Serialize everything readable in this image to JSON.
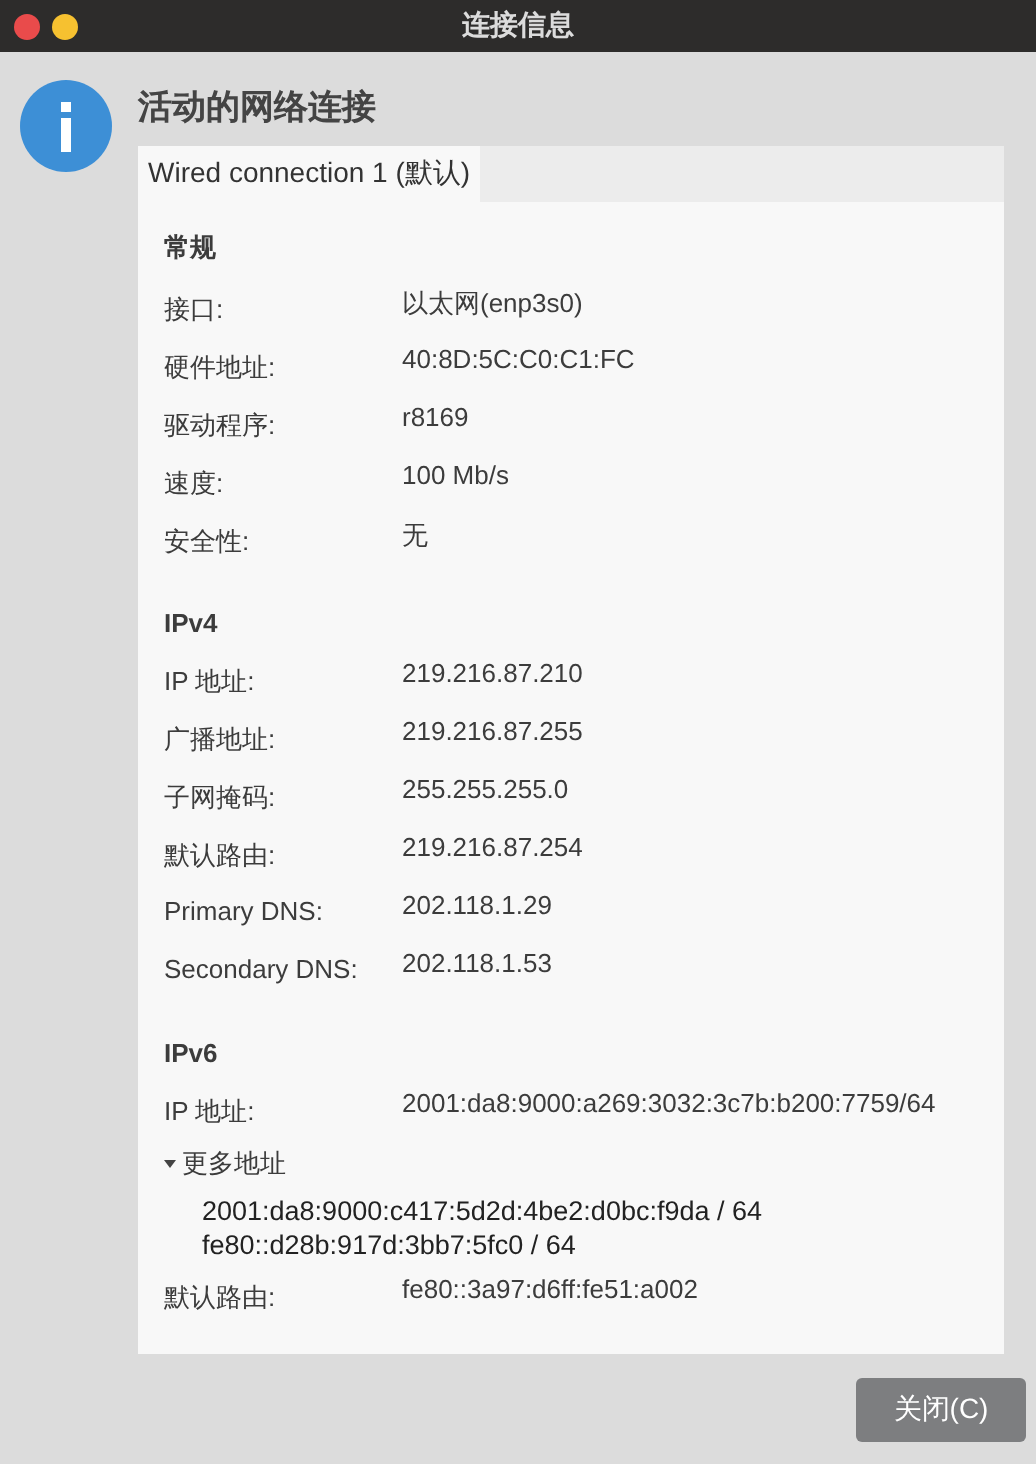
{
  "window": {
    "title": "连接信息"
  },
  "heading": "活动的网络连接",
  "tabs": [
    {
      "label": "Wired connection 1 (默认)",
      "selected": true
    }
  ],
  "sections": [
    {
      "title": "常规",
      "items": [
        {
          "kind": "field",
          "label": "接口:",
          "value": "以太网(enp3s0)"
        },
        {
          "kind": "field",
          "label": "硬件地址:",
          "value": "40:8D:5C:C0:C1:FC"
        },
        {
          "kind": "field",
          "label": "驱动程序:",
          "value": "r8169"
        },
        {
          "kind": "field",
          "label": "速度:",
          "value": "100 Mb/s"
        },
        {
          "kind": "field",
          "label": "安全性:",
          "value": "无"
        }
      ]
    },
    {
      "title": "IPv4",
      "items": [
        {
          "kind": "field",
          "label": "IP 地址:",
          "value": "219.216.87.210"
        },
        {
          "kind": "field",
          "label": "广播地址:",
          "value": "219.216.87.255"
        },
        {
          "kind": "field",
          "label": "子网掩码:",
          "value": "255.255.255.0"
        },
        {
          "kind": "field",
          "label": "默认路由:",
          "value": "219.216.87.254"
        },
        {
          "kind": "field",
          "label": "Primary DNS:",
          "value": "202.118.1.29"
        },
        {
          "kind": "field",
          "label": "Secondary DNS:",
          "value": "202.118.1.53"
        }
      ]
    },
    {
      "title": "IPv6",
      "items": [
        {
          "kind": "field",
          "label": "IP 地址:",
          "value": "2001:da8:9000:a269:3032:3c7b:b200:7759/64"
        },
        {
          "kind": "expander",
          "label": "更多地址",
          "expanded": true,
          "addresses": [
            "2001:da8:9000:c417:5d2d:4be2:d0bc:f9da / 64",
            "fe80::d28b:917d:3bb7:5fc0 / 64"
          ]
        },
        {
          "kind": "field",
          "label": "默认路由:",
          "value": "fe80::3a97:d6ff:fe51:a002"
        }
      ]
    }
  ],
  "buttons": [
    {
      "label": "关闭(C)"
    }
  ]
}
